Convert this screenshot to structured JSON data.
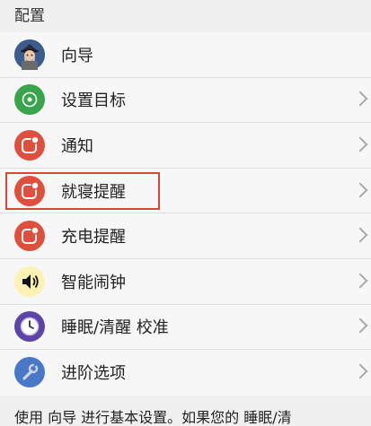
{
  "header": {
    "title": "配置"
  },
  "items": [
    {
      "label": "向导",
      "icon": "wizard-avatar-icon",
      "color": "#3c5c8f",
      "chevron": false
    },
    {
      "label": "设置目标",
      "icon": "target-icon",
      "color": "#38a54a",
      "chevron": true
    },
    {
      "label": "通知",
      "icon": "notification-icon",
      "color": "#de4f3e",
      "chevron": true
    },
    {
      "label": "就寝提醒",
      "icon": "notification-icon",
      "color": "#de4f3e",
      "chevron": true
    },
    {
      "label": "充电提醒",
      "icon": "notification-icon",
      "color": "#de4f3e",
      "chevron": true
    },
    {
      "label": "智能闹钟",
      "icon": "speaker-icon",
      "color": "#fdf1b4",
      "chevron": true
    },
    {
      "label": "睡眠/清醒 校准",
      "icon": "clock-icon",
      "color": "#5d44a8",
      "chevron": true
    },
    {
      "label": "进阶选项",
      "icon": "wrench-icon",
      "color": "#4a78c8",
      "chevron": true
    }
  ],
  "footer": {
    "text": "使用 向导 进行基本设置。如果您的 睡眠/清"
  },
  "highlight_color": "#e0403e"
}
